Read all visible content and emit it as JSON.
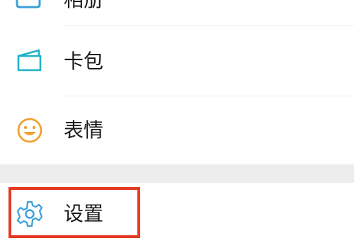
{
  "menu": {
    "items": [
      {
        "id": "album",
        "label": "相册",
        "icon": "album-icon"
      },
      {
        "id": "cards",
        "label": "卡包",
        "icon": "wallet-card-icon"
      },
      {
        "id": "stickers",
        "label": "表情",
        "icon": "smiley-icon"
      },
      {
        "id": "settings",
        "label": "设置",
        "icon": "gear-icon"
      }
    ]
  },
  "colors": {
    "icon_blue": "#3aa0d8",
    "icon_teal": "#1fb2c7",
    "icon_orange": "#f0a030",
    "highlight_red": "#e53a24",
    "section_gap": "#ededed"
  }
}
